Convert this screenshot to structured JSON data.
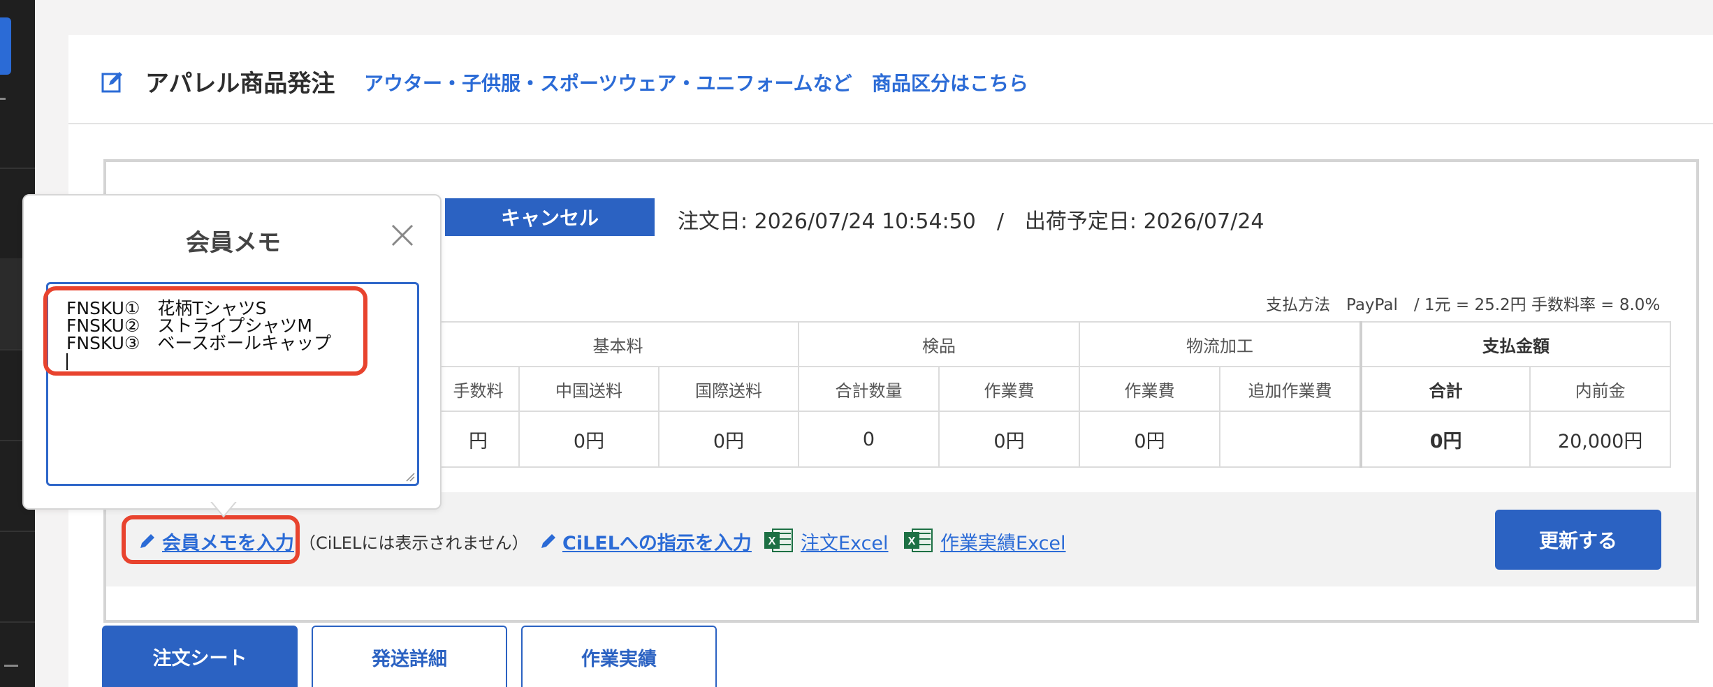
{
  "header": {
    "title": "アパレル商品発注",
    "subtitle_link": "アウター・子供服・スポーツウェア・ユニフォームなど",
    "category_link": "商品区分はこちら"
  },
  "order": {
    "cancel_label": "キャンセル",
    "dates": "注文日: 2026/07/24 10:54:50　/　出荷予定日: 2026/07/24",
    "payment_info": "支払方法　PayPal　/ 1元 = 25.2円 手数料率 = 8.0%"
  },
  "table": {
    "groups": [
      "基本料",
      "検品",
      "物流加工",
      "支払金額"
    ],
    "columns": [
      "手数料",
      "中国送料",
      "国際送料",
      "合計数量",
      "作業費",
      "作業費",
      "追加作業費",
      "合計",
      "内前金"
    ],
    "values": [
      "円",
      "0円",
      "0円",
      "0",
      "0円",
      "0円",
      "",
      "0円",
      "20,000円"
    ]
  },
  "actions": {
    "memo_link": "会員メモを入力",
    "memo_note": "（CiLELには表示されません）",
    "instruction_link": "CiLELへの指示を入力",
    "order_excel": "注文Excel",
    "work_excel": "作業実績Excel",
    "update_label": "更新する"
  },
  "tabs": [
    "注文シート",
    "発送詳細",
    "作業実績"
  ],
  "popover": {
    "title": "会員メモ",
    "memo_lines": [
      "FNSKU①　花柄TシャツS",
      "FNSKU②　ストライプシャツM",
      "FNSKU③　ベースボールキャップ"
    ]
  },
  "colors": {
    "accent": "#2b62c2",
    "link": "#2b6bd6",
    "highlight": "#e8432e"
  }
}
